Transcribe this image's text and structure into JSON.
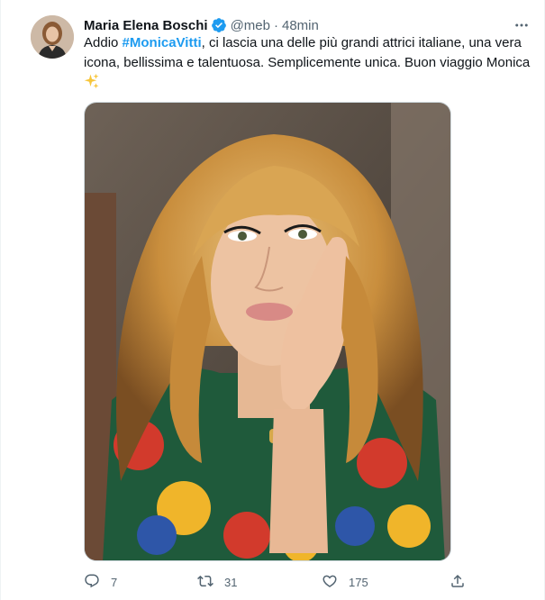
{
  "tweet": {
    "author_name": "Maria Elena Boschi",
    "handle": "@meb",
    "separator": "·",
    "time": "48min",
    "text_before": "Addio ",
    "hashtag": "#MonicaVitti",
    "text_after": ", ci lascia una delle più grandi attrici italiane, una vera icona, bellissima e talentuosa. Semplicemente unica. Buon viaggio Monica ",
    "emoji": "sparkles-emoji",
    "media_icon": "portrait-photo"
  },
  "actions": {
    "reply_count": "7",
    "retweet_count": "31",
    "like_count": "175"
  },
  "colors": {
    "accent": "#1d9bf0",
    "secondary_text": "#536471",
    "primary_text": "#0f1419"
  }
}
